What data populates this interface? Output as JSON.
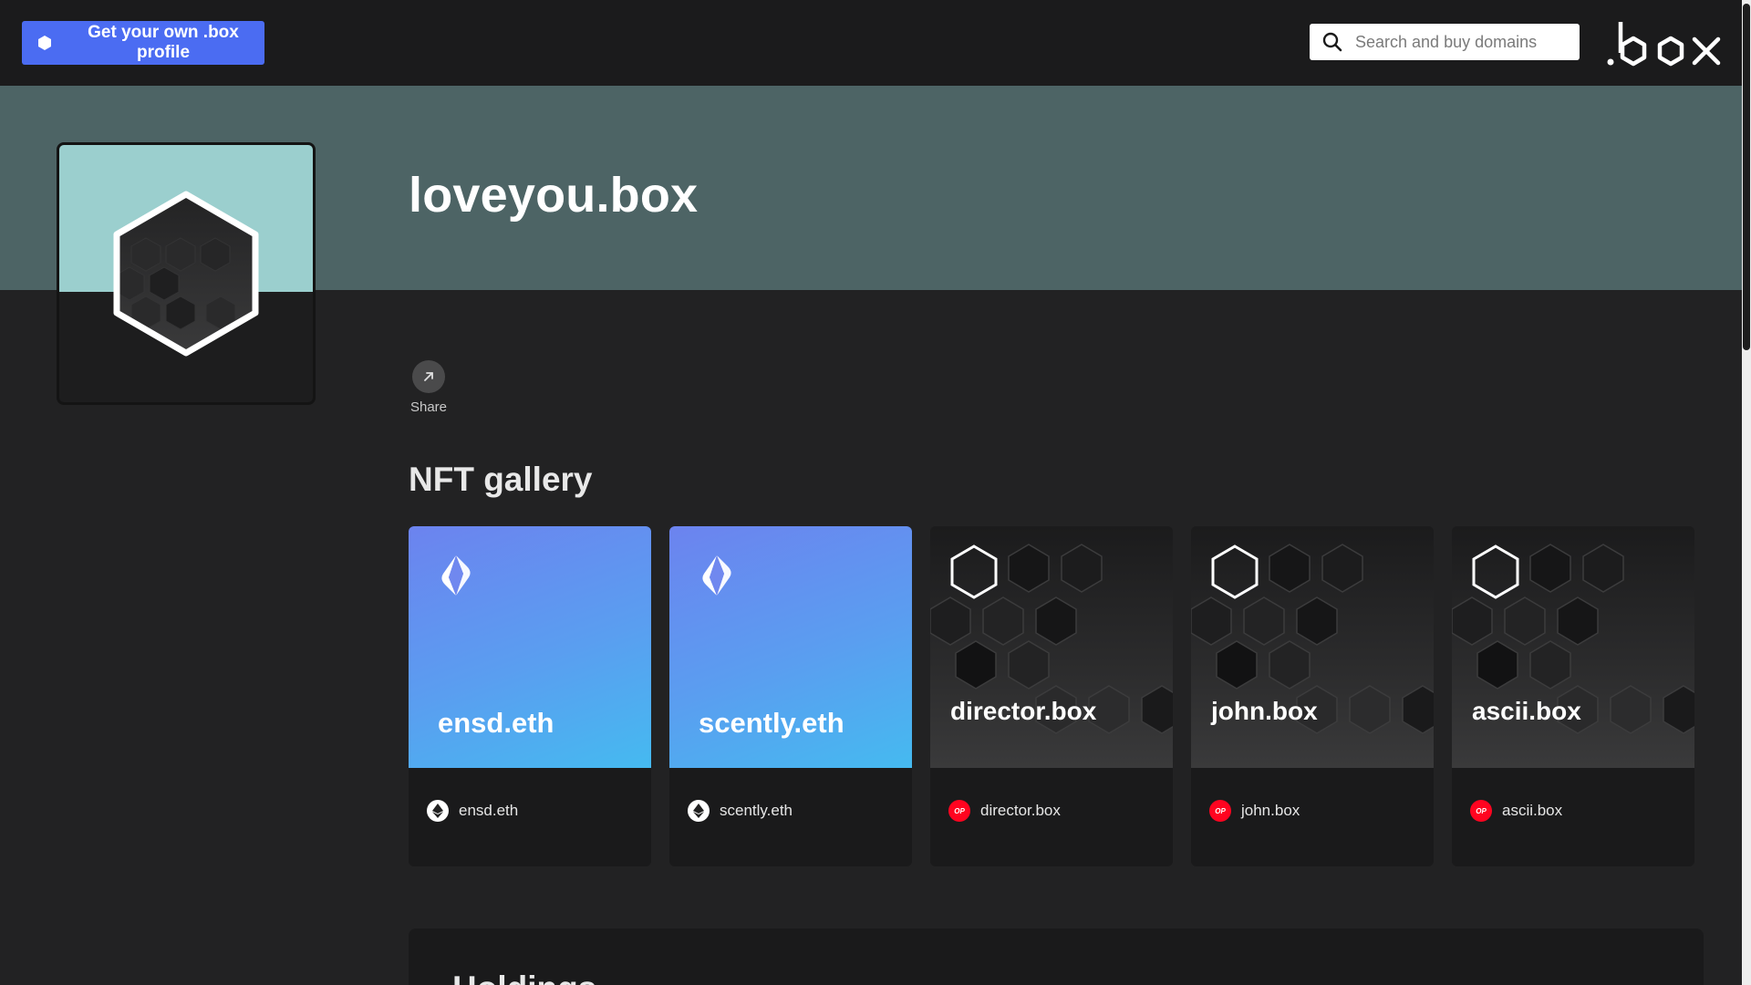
{
  "header": {
    "cta_label": "Get your own .box profile",
    "search_placeholder": "Search and buy domains",
    "logo_icon": "box-logo-icon"
  },
  "colors": {
    "accent": "#4b6cf2",
    "banner": "#4d6465",
    "avatar_bg": "#9bcfce",
    "page_bg": "#222223",
    "op_red": "#ff0420"
  },
  "profile": {
    "name": "loveyou.box",
    "share_label": "Share"
  },
  "gallery": {
    "title": "NFT gallery",
    "items": [
      {
        "title": "ensd.eth",
        "label": "ensd.eth",
        "chain_icon": "ethereum-icon",
        "art": "ens"
      },
      {
        "title": "scently.eth",
        "label": "scently.eth",
        "chain_icon": "ethereum-icon",
        "art": "ens"
      },
      {
        "title": "director.box",
        "label": "director.box",
        "chain_icon": "optimism-icon",
        "chain_text": "OP",
        "art": "box"
      },
      {
        "title": "john.box",
        "label": "john.box",
        "chain_icon": "optimism-icon",
        "chain_text": "OP",
        "art": "box"
      },
      {
        "title": "ascii.box",
        "label": "ascii.box",
        "chain_icon": "optimism-icon",
        "chain_text": "OP",
        "art": "box"
      }
    ]
  },
  "holdings": {
    "title": "Holdings"
  }
}
